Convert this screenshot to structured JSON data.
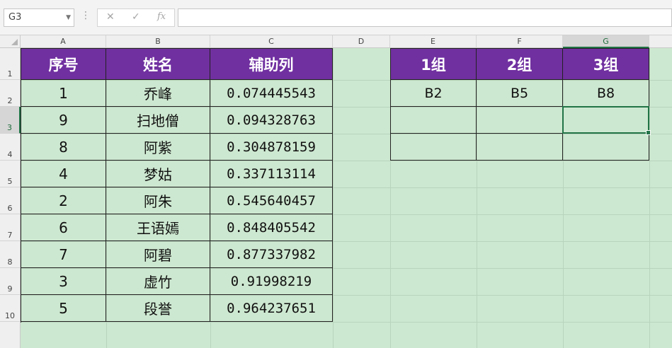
{
  "name_box": {
    "value": "G3"
  },
  "formula_bar": {
    "cancel": "✕",
    "enter": "✓",
    "fx": "fx",
    "value": ""
  },
  "columns": [
    "A",
    "B",
    "C",
    "D",
    "E",
    "F",
    "G"
  ],
  "selected_column": "G",
  "rows": [
    "1",
    "2",
    "3",
    "4",
    "5",
    "6",
    "7",
    "8",
    "9",
    "10"
  ],
  "selected_row": "3",
  "table1": {
    "headers": [
      "序号",
      "姓名",
      "辅助列"
    ],
    "rows": [
      [
        "1",
        "乔峰",
        "0.074445543"
      ],
      [
        "9",
        "扫地僧",
        "0.094328763"
      ],
      [
        "8",
        "阿紫",
        "0.304878159"
      ],
      [
        "4",
        "梦姑",
        "0.337113114"
      ],
      [
        "2",
        "阿朱",
        "0.545640457"
      ],
      [
        "6",
        "王语嫣",
        "0.848405542"
      ],
      [
        "7",
        "阿碧",
        "0.877337982"
      ],
      [
        "3",
        "虚竹",
        "0.91998219"
      ],
      [
        "5",
        "段誉",
        "0.964237651"
      ]
    ]
  },
  "table2": {
    "headers": [
      "1组",
      "2组",
      "3组"
    ],
    "rows": [
      [
        "B2",
        "B5",
        "B8"
      ],
      [
        "",
        "",
        ""
      ],
      [
        "",
        "",
        ""
      ]
    ]
  },
  "colors": {
    "header_fill": "#7030a0",
    "sheet_fill": "#cde8d0",
    "selection": "#217346"
  }
}
